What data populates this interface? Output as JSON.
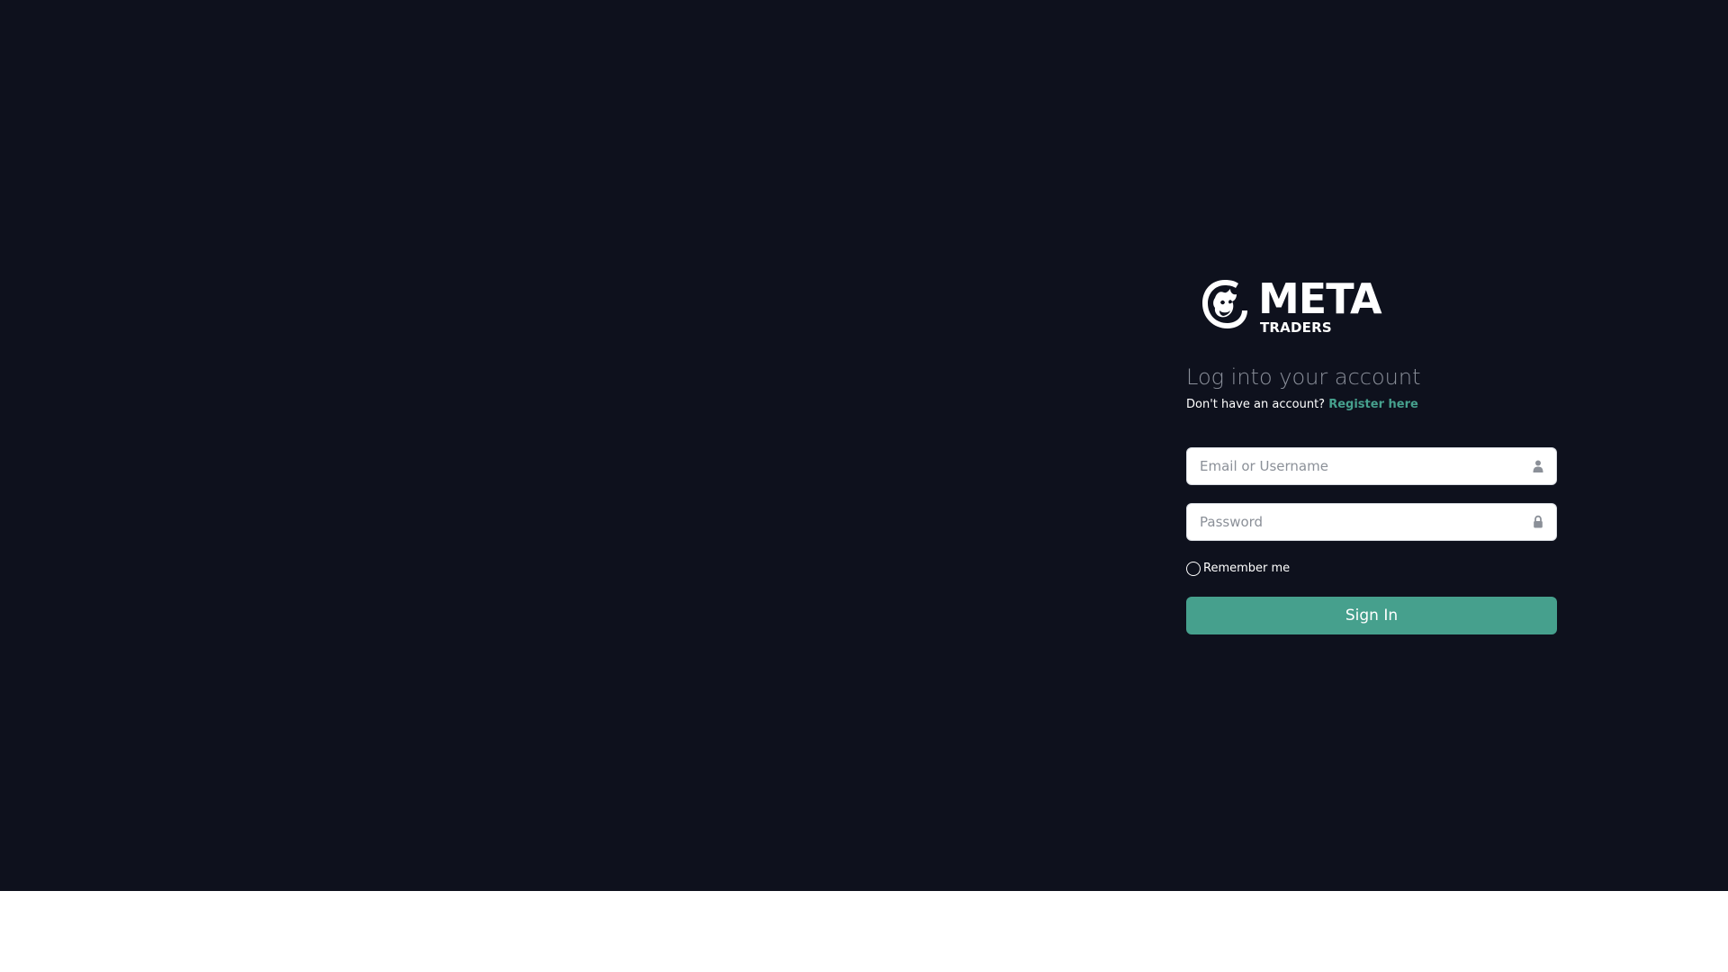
{
  "brand": {
    "name_top": "META",
    "name_bottom": "TRADERS",
    "logo_icon": "bull-head-logo-icon"
  },
  "login": {
    "title": "Log into your account",
    "no_account_text": "Don't have an account?",
    "register_link": "Register here",
    "username_placeholder": "Email or Username",
    "password_placeholder": "Password",
    "remember_label": "Remember me",
    "submit_label": "Sign In"
  },
  "colors": {
    "background": "#0e111d",
    "accent": "#46a08d",
    "heading": "#8b909b"
  },
  "icons": {
    "username": "user-icon",
    "password": "lock-icon"
  }
}
